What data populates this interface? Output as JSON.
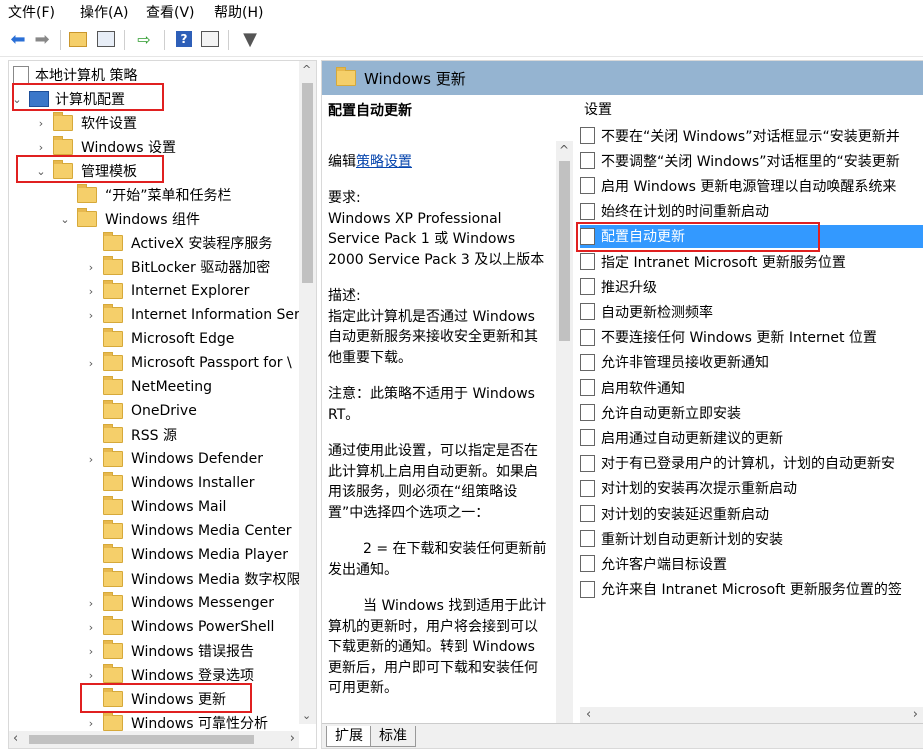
{
  "menubar": {
    "items": [
      "文件(F)",
      "操作(A)",
      "查看(V)",
      "帮助(H)"
    ]
  },
  "toolbar": {
    "icons": [
      "back-arrow-icon",
      "forward-arrow-icon",
      "up-folder-icon",
      "show-hide-tree-icon",
      "export-list-icon",
      "help-icon",
      "properties-icon",
      "filter-icon"
    ]
  },
  "tree": {
    "root": "本地计算机 策略",
    "computer_config": "计算机配置",
    "software_settings": "软件设置",
    "windows_settings": "Windows 设置",
    "admin_templates": "管理模板",
    "start_menu": "“开始”菜单和任务栏",
    "windows_components": "Windows 组件",
    "components": [
      "ActiveX 安装程序服务",
      "BitLocker 驱动器加密",
      "Internet Explorer",
      "Internet Information Ser",
      "Microsoft Edge",
      "Microsoft Passport for \\",
      "NetMeeting",
      "OneDrive",
      "RSS 源",
      "Windows Defender",
      "Windows Installer",
      "Windows Mail",
      "Windows Media Center",
      "Windows Media Player",
      "Windows Media 数字权限",
      "Windows Messenger",
      "Windows PowerShell",
      "Windows 错误报告",
      "Windows 登录选项",
      "Windows 更新",
      "Windows 可靠性分析"
    ]
  },
  "right": {
    "header": "Windows 更新",
    "setting_title": "配置自动更新",
    "edit_prefix": "编辑",
    "edit_link": "策略设置",
    "requirements_label": "要求:",
    "requirements": "Windows XP Professional Service Pack 1 或 Windows 2000 Service Pack 3 及以上版本",
    "description_label": "描述:",
    "description": "指定此计算机是否通过 Windows 自动更新服务来接收安全更新和其他重要下载。",
    "note": "注意：此策略不适用于 Windows RT。",
    "para1": "通过使用此设置，可以指定是否在此计算机上启用自动更新。如果启用该服务，则必须在“组策略设置”中选择四个选项之一：",
    "para2": "2 = 在下载和安装任何更新前发出通知。",
    "para3": "当 Windows 找到适用于此计算机的更新时，用户将会接到可以下载更新的通知。转到 Windows 更新后，用户即可下载和安装任何可用更新。",
    "settings_header": "设置",
    "settings": [
      "不要在“关闭 Windows”对话框显示“安装更新并",
      "不要调整“关闭 Windows”对话框里的“安装更新",
      "启用 Windows 更新电源管理以自动唤醒系统来",
      "始终在计划的时间重新启动",
      "配置自动更新",
      "指定 Intranet Microsoft 更新服务位置",
      "推迟升级",
      "自动更新检测频率",
      "不要连接任何 Windows 更新 Internet 位置",
      "允许非管理员接收更新通知",
      "启用软件通知",
      "允许自动更新立即安装",
      "启用通过自动更新建议的更新",
      "对于有已登录用户的计算机，计划的自动更新安",
      "对计划的安装再次提示重新启动",
      "对计划的安装延迟重新启动",
      "重新计划自动更新计划的安装",
      "允许客户端目标设置",
      "允许来自 Intranet Microsoft 更新服务位置的签"
    ],
    "selected_index": 4,
    "tabs": [
      "扩展",
      "标准"
    ]
  },
  "colors": {
    "header_bg": "#95b4d1",
    "selection": "#3399ff",
    "annotation_red": "#e02020"
  }
}
